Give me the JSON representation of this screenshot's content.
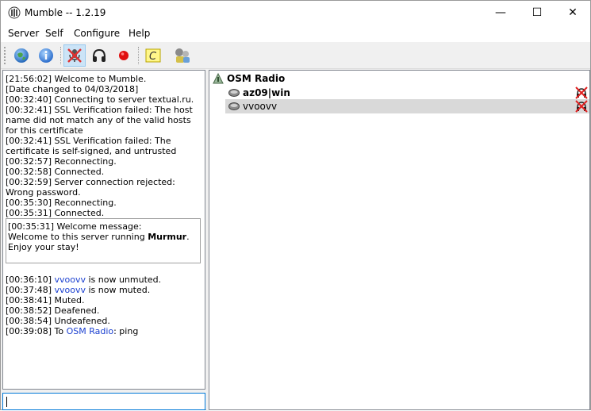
{
  "window": {
    "title": "Mumble -- 1.2.19",
    "minimize_glyph": "—",
    "maximize_glyph": "☐",
    "close_glyph": "✕"
  },
  "menu": {
    "items": [
      "Server",
      "Self",
      "Configure",
      "Help"
    ]
  },
  "toolbar": {
    "buttons": [
      {
        "icon": "globe-connect-icon"
      },
      {
        "icon": "info-icon"
      },
      {
        "icon": "mute-self-icon",
        "pressed": true
      },
      {
        "icon": "deafen-headphones-icon"
      },
      {
        "icon": "record-icon"
      },
      {
        "icon": "comment-icon"
      },
      {
        "icon": "audio-wizard-icon"
      }
    ]
  },
  "log": {
    "lines": [
      "[21:56:02] Welcome to Mumble.",
      "[Date changed to 04/03/2018]",
      "[00:32:40] Connecting to server textual.ru.",
      "[00:32:41] SSL Verification failed: The host name did not match any of the valid hosts for this certificate",
      "[00:32:41] SSL Verification failed: The certificate is self-signed, and untrusted",
      "[00:32:57] Reconnecting.",
      "[00:32:58] Connected.",
      "[00:32:59] Server connection rejected: Wrong password.",
      "[00:35:30] Reconnecting.",
      "[00:35:31] Connected."
    ],
    "welcome": {
      "header": "[00:35:31] Welcome message:",
      "line1_prefix": "Welcome to this server running ",
      "line1_bold": "Murmur",
      "line1_suffix": ".",
      "line2": "Enjoy your stay!"
    },
    "events": [
      {
        "time": "[00:36:10] ",
        "link": "vvoovv",
        "text": " is now unmuted."
      },
      {
        "time": "[00:37:48] ",
        "link": "vvoovv",
        "text": " is now muted."
      },
      {
        "time": "[00:38:41] ",
        "link": "",
        "text": "Muted."
      },
      {
        "time": "[00:38:52] ",
        "link": "",
        "text": "Deafened."
      },
      {
        "time": "[00:38:54] ",
        "link": "",
        "text": "Undeafened."
      },
      {
        "time": "[00:39:08] To ",
        "link": "OSM Radio",
        "text": ": ping"
      }
    ]
  },
  "chat_input": {
    "value": ""
  },
  "tree": {
    "channel": "OSM Radio",
    "users": [
      {
        "name": "az09|win",
        "bold": true,
        "selected": false
      },
      {
        "name": "vvoovv",
        "bold": false,
        "selected": true
      }
    ]
  },
  "colors": {
    "link": "#1a3fd0",
    "selection": "#d9d9d9",
    "accent": "#0078d7"
  }
}
